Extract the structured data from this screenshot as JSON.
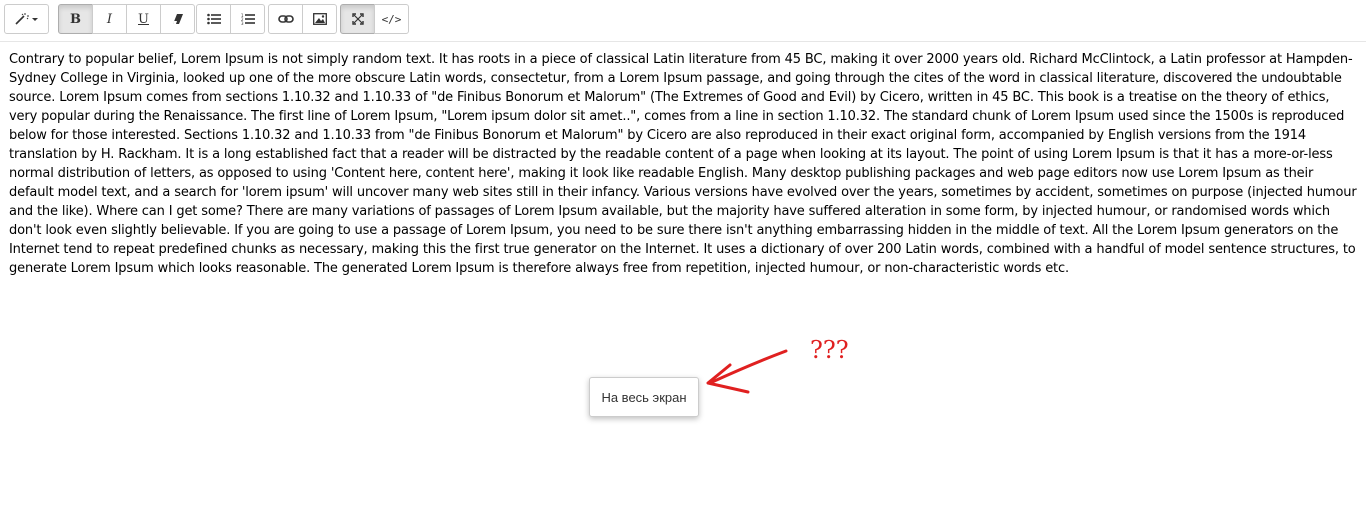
{
  "toolbar": {
    "groups": [
      [
        {
          "icon": "magic-wand-icon",
          "label": ""
        }
      ],
      [
        {
          "label": "B"
        },
        {
          "label": "I"
        },
        {
          "label": "U"
        },
        {
          "icon": "eraser-icon",
          "label": ""
        }
      ],
      [
        {
          "icon": "unordered-list-icon"
        },
        {
          "icon": "ordered-list-icon"
        }
      ],
      [
        {
          "icon": "link-icon"
        },
        {
          "icon": "picture-icon"
        }
      ],
      [
        {
          "icon": "fullscreen-icon"
        },
        {
          "label": "</>"
        }
      ]
    ],
    "bold_label": "B",
    "italic_label": "I",
    "underline_label": "U",
    "codeview_label": "</>"
  },
  "editor": {
    "text": "Contrary to popular belief, Lorem Ipsum is not simply random text. It has roots in a piece of classical Latin literature from 45 BC, making it over 2000 years old. Richard McClintock, a Latin professor at Hampden-Sydney College in Virginia, looked up one of the more obscure Latin words, consectetur, from a Lorem Ipsum passage, and going through the cites of the word in classical literature, discovered the undoubtable source. Lorem Ipsum comes from sections 1.10.32 and 1.10.33 of \"de Finibus Bonorum et Malorum\" (The Extremes of Good and Evil) by Cicero, written in 45 BC. This book is a treatise on the theory of ethics, very popular during the Renaissance. The first line of Lorem Ipsum, \"Lorem ipsum dolor sit amet..\", comes from a line in section 1.10.32. The standard chunk of Lorem Ipsum used since the 1500s is reproduced below for those interested. Sections 1.10.32 and 1.10.33 from \"de Finibus Bonorum et Malorum\" by Cicero are also reproduced in their exact original form, accompanied by English versions from the 1914 translation by H. Rackham. It is a long established fact that a reader will be distracted by the readable content of a page when looking at its layout. The point of using Lorem Ipsum is that it has a more-or-less normal distribution of letters, as opposed to using 'Content here, content here', making it look like readable English. Many desktop publishing packages and web page editors now use Lorem Ipsum as their default model text, and a search for 'lorem ipsum' will uncover many web sites still in their infancy. Various versions have evolved over the years, sometimes by accident, sometimes on purpose (injected humour and the like). Where can I get some? There are many variations of passages of Lorem Ipsum available, but the majority have suffered alteration in some form, by injected humour, or randomised words which don't look even slightly believable. If you are going to use a passage of Lorem Ipsum, you need to be sure there isn't anything embarrassing hidden in the middle of text. All the Lorem Ipsum generators on the Internet tend to repeat predefined chunks as necessary, making this the first true generator on the Internet. It uses a dictionary of over 200 Latin words, combined with a handful of model sentence structures, to generate Lorem Ipsum which looks reasonable. The generated Lorem Ipsum is therefore always free from repetition, injected humour, or non-characteristic words etc."
  },
  "tooltip": {
    "text": "На весь экран"
  },
  "annotation": {
    "text": "???",
    "color": "#e02020"
  }
}
